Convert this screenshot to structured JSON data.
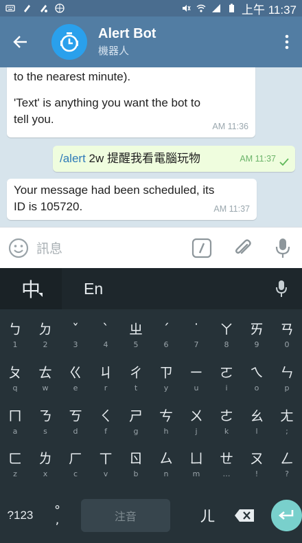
{
  "status_bar": {
    "time": "上午 11:37"
  },
  "header": {
    "title": "Alert Bot",
    "subtitle": "機器人"
  },
  "messages": [
    {
      "line1": "to the nearest minute).",
      "line2": "",
      "line3": "'Text' is anything you want the bot to",
      "line4": "tell you.",
      "time": "AM 11:36"
    },
    {
      "command": "/alert",
      "text": " 2w 提醒我看電腦玩物",
      "time": "AM 11:37"
    },
    {
      "line1": "Your message had been scheduled, its",
      "line2": "ID is 105720.",
      "time": "AM 11:37"
    }
  ],
  "composer": {
    "placeholder": "訊息"
  },
  "keyboard": {
    "lang_label": "中",
    "alt_lang_label": "En",
    "row1": [
      {
        "main": "ㄅ",
        "sub": "1"
      },
      {
        "main": "ㄉ",
        "sub": "2"
      },
      {
        "main": "ˇ",
        "sub": "3"
      },
      {
        "main": "ˋ",
        "sub": "4"
      },
      {
        "main": "ㄓ",
        "sub": "5"
      },
      {
        "main": "ˊ",
        "sub": "6"
      },
      {
        "main": "˙",
        "sub": "7"
      },
      {
        "main": "ㄚ",
        "sub": "8"
      },
      {
        "main": "ㄞ",
        "sub": "9"
      },
      {
        "main": "ㄢ",
        "sub": "0"
      }
    ],
    "row2": [
      {
        "main": "ㄆ",
        "sub": "q"
      },
      {
        "main": "ㄊ",
        "sub": "w"
      },
      {
        "main": "ㄍ",
        "sub": "e"
      },
      {
        "main": "ㄐ",
        "sub": "r"
      },
      {
        "main": "ㄔ",
        "sub": "t"
      },
      {
        "main": "ㄗ",
        "sub": "y"
      },
      {
        "main": "ㄧ",
        "sub": "u"
      },
      {
        "main": "ㄛ",
        "sub": "i"
      },
      {
        "main": "ㄟ",
        "sub": "o"
      },
      {
        "main": "ㄣ",
        "sub": "p"
      }
    ],
    "row3": [
      {
        "main": "ㄇ",
        "sub": "a"
      },
      {
        "main": "ㄋ",
        "sub": "s"
      },
      {
        "main": "ㄎ",
        "sub": "d"
      },
      {
        "main": "ㄑ",
        "sub": "f"
      },
      {
        "main": "ㄕ",
        "sub": "g"
      },
      {
        "main": "ㄘ",
        "sub": "h"
      },
      {
        "main": "ㄨ",
        "sub": "j"
      },
      {
        "main": "ㄜ",
        "sub": "k"
      },
      {
        "main": "ㄠ",
        "sub": "l"
      },
      {
        "main": "ㄤ",
        "sub": ";"
      }
    ],
    "row4": [
      {
        "main": "ㄈ",
        "sub": "z"
      },
      {
        "main": "ㄌ",
        "sub": "x"
      },
      {
        "main": "ㄏ",
        "sub": "c"
      },
      {
        "main": "ㄒ",
        "sub": "v"
      },
      {
        "main": "ㄖ",
        "sub": "b"
      },
      {
        "main": "ㄙ",
        "sub": "n"
      },
      {
        "main": "ㄩ",
        "sub": "m"
      },
      {
        "main": "ㄝ",
        "sub": "…"
      },
      {
        "main": "ㄡ",
        "sub": "!"
      },
      {
        "main": "ㄥ",
        "sub": "?"
      }
    ],
    "key_123": "?123",
    "key_degree": "°",
    "key_comma": ",",
    "space_label": "注音",
    "key_er": "ㄦ"
  }
}
